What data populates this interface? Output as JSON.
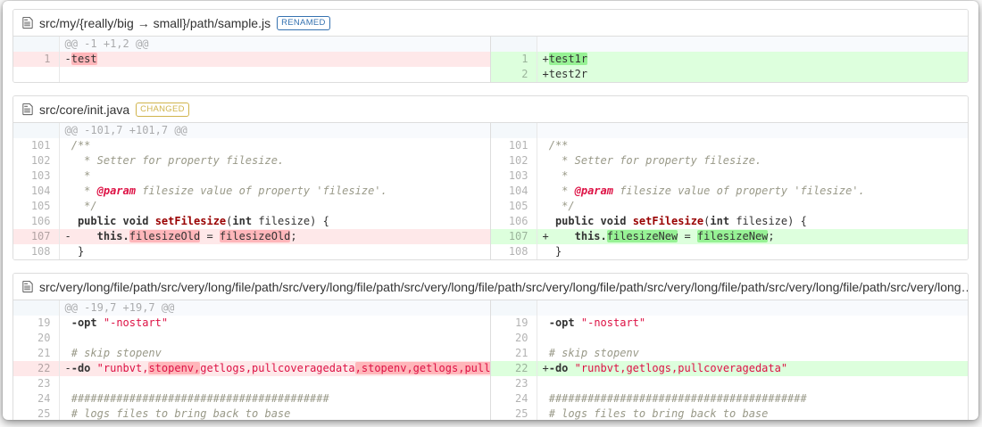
{
  "colors": {
    "renamed_tag": "#3572b0",
    "changed_tag": "#d0b44c",
    "deletion_row_bg": "#fee8e9",
    "deletion_word_bg": "#ffb6ba",
    "insertion_row_bg": "#ddffdd",
    "insertion_word_bg": "#97f295",
    "hunk_header_bg": "#f8fafd"
  },
  "files": [
    {
      "name": "src/my/{really/big → small}/path/sample.js",
      "tag": {
        "label": "RENAMED",
        "color": "#3572b0"
      },
      "left_rows": [
        {
          "t": "info",
          "text": "@@ -1 +1,2 @@"
        },
        {
          "t": "del",
          "n": "1",
          "segs": [
            {
              "t": "-"
            },
            {
              "t": "test",
              "s": "hl"
            }
          ]
        },
        {
          "t": "empty"
        }
      ],
      "right_rows": [
        {
          "t": "info",
          "text": ""
        },
        {
          "t": "ins",
          "n": "1",
          "segs": [
            {
              "t": "+"
            },
            {
              "t": "test1r",
              "s": "hl"
            }
          ]
        },
        {
          "t": "ins",
          "n": "2",
          "segs": [
            {
              "t": "+test2r"
            }
          ]
        }
      ]
    },
    {
      "name": "src/core/init.java",
      "tag": {
        "label": "CHANGED",
        "color": "#d0b44c"
      },
      "left_rows": [
        {
          "t": "info",
          "text": "@@ -101,7 +101,7 @@"
        },
        {
          "t": "ctx",
          "n": "101",
          "segs": [
            {
              "t": " /**",
              "s": "cmt"
            }
          ]
        },
        {
          "t": "ctx",
          "n": "102",
          "segs": [
            {
              "t": "   * Setter for property filesize.",
              "s": "cmt"
            }
          ]
        },
        {
          "t": "ctx",
          "n": "103",
          "segs": [
            {
              "t": "   *",
              "s": "cmt"
            }
          ]
        },
        {
          "t": "ctx",
          "n": "104",
          "segs": [
            {
              "t": "   * ",
              "s": "cmt"
            },
            {
              "t": "@param",
              "s": "doctag"
            },
            {
              "t": " filesize value of property 'filesize'.",
              "s": "cmt"
            }
          ]
        },
        {
          "t": "ctx",
          "n": "105",
          "segs": [
            {
              "t": "   */",
              "s": "cmt"
            }
          ]
        },
        {
          "t": "ctx",
          "n": "106",
          "segs": [
            {
              "t": "  "
            },
            {
              "t": "public",
              "s": "kw"
            },
            {
              "t": " "
            },
            {
              "t": "void",
              "s": "kw"
            },
            {
              "t": " "
            },
            {
              "t": "setFilesize",
              "s": "title"
            },
            {
              "t": "("
            },
            {
              "t": "int",
              "s": "kw"
            },
            {
              "t": " filesize) {"
            }
          ]
        },
        {
          "t": "del",
          "n": "107",
          "segs": [
            {
              "t": "-    "
            },
            {
              "t": "this.",
              "s": "kw"
            },
            {
              "t": "filesizeOld",
              "s": "hl"
            },
            {
              "t": " = "
            },
            {
              "t": "filesizeOld",
              "s": "hl"
            },
            {
              "t": ";"
            }
          ]
        },
        {
          "t": "ctx",
          "n": "108",
          "segs": [
            {
              "t": "  }"
            }
          ]
        }
      ],
      "right_rows": [
        {
          "t": "info",
          "text": ""
        },
        {
          "t": "ctx",
          "n": "101",
          "segs": [
            {
              "t": " /**",
              "s": "cmt"
            }
          ]
        },
        {
          "t": "ctx",
          "n": "102",
          "segs": [
            {
              "t": "   * Setter for property filesize.",
              "s": "cmt"
            }
          ]
        },
        {
          "t": "ctx",
          "n": "103",
          "segs": [
            {
              "t": "   *",
              "s": "cmt"
            }
          ]
        },
        {
          "t": "ctx",
          "n": "104",
          "segs": [
            {
              "t": "   * ",
              "s": "cmt"
            },
            {
              "t": "@param",
              "s": "doctag"
            },
            {
              "t": " filesize value of property 'filesize'.",
              "s": "cmt"
            }
          ]
        },
        {
          "t": "ctx",
          "n": "105",
          "segs": [
            {
              "t": "   */",
              "s": "cmt"
            }
          ]
        },
        {
          "t": "ctx",
          "n": "106",
          "segs": [
            {
              "t": "  "
            },
            {
              "t": "public",
              "s": "kw"
            },
            {
              "t": " "
            },
            {
              "t": "void",
              "s": "kw"
            },
            {
              "t": " "
            },
            {
              "t": "setFilesize",
              "s": "title"
            },
            {
              "t": "("
            },
            {
              "t": "int",
              "s": "kw"
            },
            {
              "t": " filesize) {"
            }
          ]
        },
        {
          "t": "ins",
          "n": "107",
          "segs": [
            {
              "t": "+    "
            },
            {
              "t": "this.",
              "s": "kw"
            },
            {
              "t": "filesizeNew",
              "s": "hl"
            },
            {
              "t": " = "
            },
            {
              "t": "filesizeNew",
              "s": "hl"
            },
            {
              "t": ";"
            }
          ]
        },
        {
          "t": "ctx",
          "n": "108",
          "segs": [
            {
              "t": "  }"
            }
          ]
        }
      ]
    },
    {
      "name": "src/very/long/file/path/src/very/long/file/path/src/very/long/file/path/src/very/long/file/path/src/very/long/file/path/src/very/long/file/path/src/very/long/file/path/src/very/long…",
      "tag": {
        "label": "CHANGED",
        "color": "#d0b44c"
      },
      "left_rows": [
        {
          "t": "info",
          "text": "@@ -19,7 +19,7 @@"
        },
        {
          "t": "ctx",
          "n": "19",
          "segs": [
            {
              "t": " "
            },
            {
              "t": "-opt",
              "s": "kw"
            },
            {
              "t": " "
            },
            {
              "t": "\"-nostart\"",
              "s": "str"
            }
          ]
        },
        {
          "t": "ctx",
          "n": "20",
          "segs": [
            {
              "t": " "
            }
          ]
        },
        {
          "t": "ctx",
          "n": "21",
          "segs": [
            {
              "t": " "
            },
            {
              "t": "# skip stopenv",
              "s": "cmt"
            }
          ]
        },
        {
          "t": "del",
          "n": "22",
          "segs": [
            {
              "t": "-"
            },
            {
              "t": "-do",
              "s": "kw"
            },
            {
              "t": " "
            },
            {
              "t": "\"runbvt,",
              "s": "str"
            },
            {
              "t": "stopenv,",
              "s": "str hl"
            },
            {
              "t": "getlogs,pullcoveragedata",
              "s": "str"
            },
            {
              "t": ",stopenv,getlogs,pullcoveragedata\"",
              "s": "str hl"
            }
          ]
        },
        {
          "t": "ctx",
          "n": "23",
          "segs": [
            {
              "t": " "
            }
          ]
        },
        {
          "t": "ctx",
          "n": "24",
          "segs": [
            {
              "t": " "
            },
            {
              "t": "########################################",
              "s": "cmt"
            }
          ]
        },
        {
          "t": "ctx",
          "n": "25",
          "segs": [
            {
              "t": " "
            },
            {
              "t": "# logs files to bring back to base",
              "s": "cmt"
            }
          ]
        }
      ],
      "right_rows": [
        {
          "t": "info",
          "text": ""
        },
        {
          "t": "ctx",
          "n": "19",
          "segs": [
            {
              "t": " "
            },
            {
              "t": "-opt",
              "s": "kw"
            },
            {
              "t": " "
            },
            {
              "t": "\"-nostart\"",
              "s": "str"
            }
          ]
        },
        {
          "t": "ctx",
          "n": "20",
          "segs": [
            {
              "t": " "
            }
          ]
        },
        {
          "t": "ctx",
          "n": "21",
          "segs": [
            {
              "t": " "
            },
            {
              "t": "# skip stopenv",
              "s": "cmt"
            }
          ]
        },
        {
          "t": "ins",
          "n": "22",
          "segs": [
            {
              "t": "+"
            },
            {
              "t": "-do",
              "s": "kw"
            },
            {
              "t": " "
            },
            {
              "t": "\"runbvt,getlogs,pullcoveragedata\"",
              "s": "str"
            }
          ]
        },
        {
          "t": "ctx",
          "n": "23",
          "segs": [
            {
              "t": " "
            }
          ]
        },
        {
          "t": "ctx",
          "n": "24",
          "segs": [
            {
              "t": " "
            },
            {
              "t": "########################################",
              "s": "cmt"
            }
          ]
        },
        {
          "t": "ctx",
          "n": "25",
          "segs": [
            {
              "t": " "
            },
            {
              "t": "# logs files to bring back to base",
              "s": "cmt"
            }
          ]
        }
      ]
    }
  ]
}
